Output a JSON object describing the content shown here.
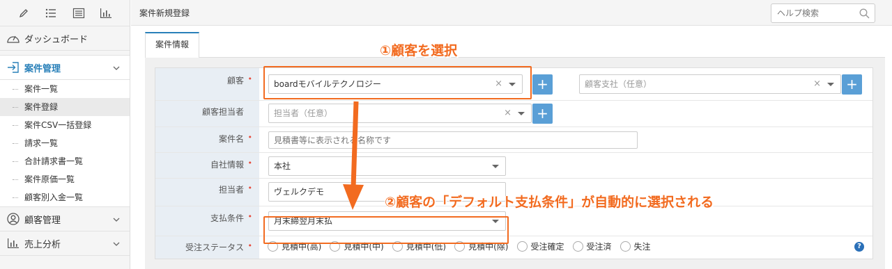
{
  "colors": {
    "accent": "#2980b9",
    "annotation": "#f26b20",
    "add_button": "#5a9fd6"
  },
  "sidebar": {
    "toolbar_icons": [
      "pencil-icon",
      "list-icon",
      "table-icon",
      "bar-chart-icon"
    ],
    "dashboard_label": "ダッシュボード",
    "cases": {
      "label": "案件管理",
      "items": [
        "案件一覧",
        "案件登録",
        "案件CSV一括登録",
        "請求一覧",
        "合計請求書一覧",
        "案件原価一覧",
        "顧客別入金一覧"
      ],
      "current": "案件登録"
    },
    "customers_label": "顧客管理",
    "analytics_label": "売上分析"
  },
  "header": {
    "title": "案件新規登録",
    "help_placeholder": "ヘルプ検索"
  },
  "tab": {
    "label": "案件情報"
  },
  "form": {
    "customer": {
      "label": "顧客",
      "value": "boardモバイルテクノロジー",
      "branch_placeholder": "顧客支社（任意）",
      "clear": "×"
    },
    "contact": {
      "label": "顧客担当者",
      "placeholder": "担当者（任意）",
      "clear": "×"
    },
    "name": {
      "label": "案件名",
      "placeholder": "見積書等に表示される名称です"
    },
    "company": {
      "label": "自社情報",
      "value": "本社"
    },
    "staff": {
      "label": "担当者",
      "value": "ヴェルクデモ"
    },
    "payment": {
      "label": "支払条件",
      "value": "月末締翌月末払"
    },
    "status": {
      "label": "受注ステータス",
      "options": [
        "見積中(高)",
        "見積中(中)",
        "見積中(低)",
        "見積中(除)",
        "受注確定",
        "受注済",
        "失注"
      ]
    },
    "required_mark": "•",
    "plus": "+",
    "help": "?"
  },
  "annotations": {
    "step1": "①顧客を選択",
    "step2": "②顧客の「デフォルト支払条件」が自動的に選択される"
  }
}
